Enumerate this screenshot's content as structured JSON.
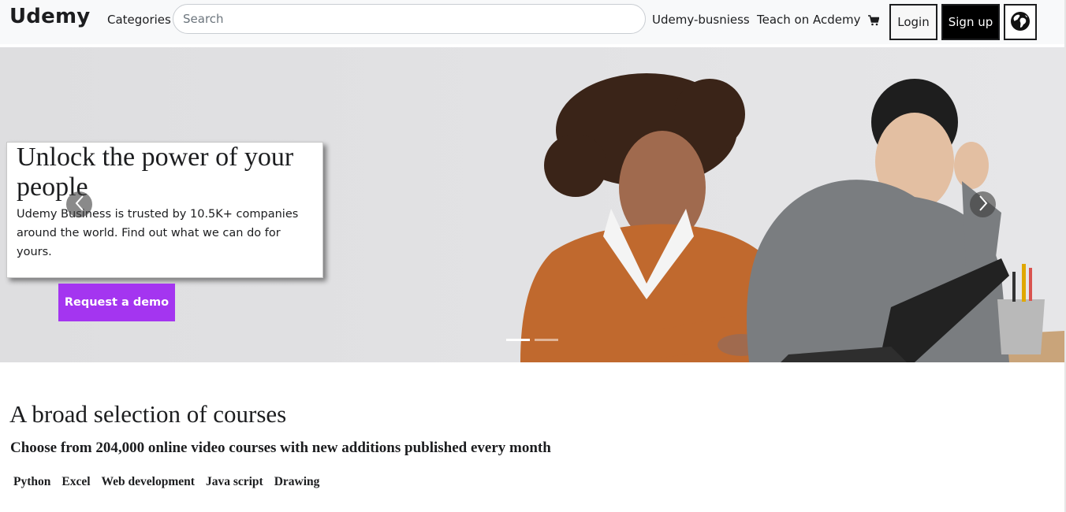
{
  "navbar": {
    "brand": "Udemy",
    "categories": "Categories",
    "search_placeholder": "Search",
    "business": "Udemy-busniess",
    "teach": "Teach on Acdemy",
    "login": "Login",
    "signup": "Sign up",
    "icons": {
      "cart": "cart-icon",
      "globe": "globe-icon"
    }
  },
  "hero": {
    "title": "Unlock the power of your people",
    "text": "Udemy Business is trusted by 10.5K+ companies around the world. Find out what we can do for yours.",
    "cta": "Request a demo",
    "slide_count": 2,
    "active_slide": 1
  },
  "courses": {
    "title": "A broad selection of courses",
    "subtitle": "Choose from 204,000 online video courses with new additions published every month",
    "topics": [
      "Python",
      "Excel",
      "Web development",
      "Java script",
      "Drawing"
    ]
  },
  "colors": {
    "accent": "#a435f0",
    "navbar_bg": "#f8f9fa",
    "hero_bg": "#e2e2e4"
  }
}
